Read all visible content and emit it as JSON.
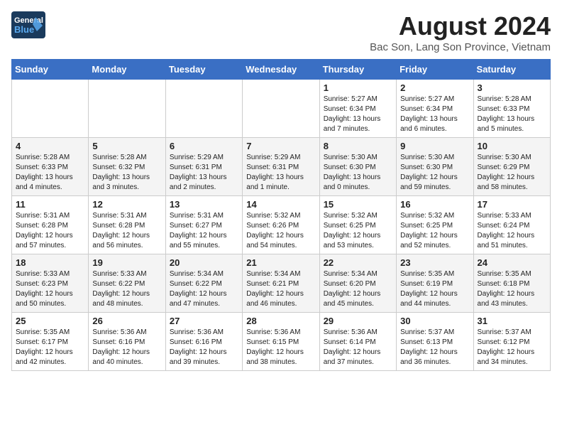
{
  "header": {
    "logo_text_general": "General",
    "logo_text_blue": "Blue",
    "month_title": "August 2024",
    "location": "Bac Son, Lang Son Province, Vietnam"
  },
  "weekdays": [
    "Sunday",
    "Monday",
    "Tuesday",
    "Wednesday",
    "Thursday",
    "Friday",
    "Saturday"
  ],
  "weeks": [
    [
      {
        "day": "",
        "info": ""
      },
      {
        "day": "",
        "info": ""
      },
      {
        "day": "",
        "info": ""
      },
      {
        "day": "",
        "info": ""
      },
      {
        "day": "1",
        "info": "Sunrise: 5:27 AM\nSunset: 6:34 PM\nDaylight: 13 hours\nand 7 minutes."
      },
      {
        "day": "2",
        "info": "Sunrise: 5:27 AM\nSunset: 6:34 PM\nDaylight: 13 hours\nand 6 minutes."
      },
      {
        "day": "3",
        "info": "Sunrise: 5:28 AM\nSunset: 6:33 PM\nDaylight: 13 hours\nand 5 minutes."
      }
    ],
    [
      {
        "day": "4",
        "info": "Sunrise: 5:28 AM\nSunset: 6:33 PM\nDaylight: 13 hours\nand 4 minutes."
      },
      {
        "day": "5",
        "info": "Sunrise: 5:28 AM\nSunset: 6:32 PM\nDaylight: 13 hours\nand 3 minutes."
      },
      {
        "day": "6",
        "info": "Sunrise: 5:29 AM\nSunset: 6:31 PM\nDaylight: 13 hours\nand 2 minutes."
      },
      {
        "day": "7",
        "info": "Sunrise: 5:29 AM\nSunset: 6:31 PM\nDaylight: 13 hours\nand 1 minute."
      },
      {
        "day": "8",
        "info": "Sunrise: 5:30 AM\nSunset: 6:30 PM\nDaylight: 13 hours\nand 0 minutes."
      },
      {
        "day": "9",
        "info": "Sunrise: 5:30 AM\nSunset: 6:30 PM\nDaylight: 12 hours\nand 59 minutes."
      },
      {
        "day": "10",
        "info": "Sunrise: 5:30 AM\nSunset: 6:29 PM\nDaylight: 12 hours\nand 58 minutes."
      }
    ],
    [
      {
        "day": "11",
        "info": "Sunrise: 5:31 AM\nSunset: 6:28 PM\nDaylight: 12 hours\nand 57 minutes."
      },
      {
        "day": "12",
        "info": "Sunrise: 5:31 AM\nSunset: 6:28 PM\nDaylight: 12 hours\nand 56 minutes."
      },
      {
        "day": "13",
        "info": "Sunrise: 5:31 AM\nSunset: 6:27 PM\nDaylight: 12 hours\nand 55 minutes."
      },
      {
        "day": "14",
        "info": "Sunrise: 5:32 AM\nSunset: 6:26 PM\nDaylight: 12 hours\nand 54 minutes."
      },
      {
        "day": "15",
        "info": "Sunrise: 5:32 AM\nSunset: 6:25 PM\nDaylight: 12 hours\nand 53 minutes."
      },
      {
        "day": "16",
        "info": "Sunrise: 5:32 AM\nSunset: 6:25 PM\nDaylight: 12 hours\nand 52 minutes."
      },
      {
        "day": "17",
        "info": "Sunrise: 5:33 AM\nSunset: 6:24 PM\nDaylight: 12 hours\nand 51 minutes."
      }
    ],
    [
      {
        "day": "18",
        "info": "Sunrise: 5:33 AM\nSunset: 6:23 PM\nDaylight: 12 hours\nand 50 minutes."
      },
      {
        "day": "19",
        "info": "Sunrise: 5:33 AM\nSunset: 6:22 PM\nDaylight: 12 hours\nand 48 minutes."
      },
      {
        "day": "20",
        "info": "Sunrise: 5:34 AM\nSunset: 6:22 PM\nDaylight: 12 hours\nand 47 minutes."
      },
      {
        "day": "21",
        "info": "Sunrise: 5:34 AM\nSunset: 6:21 PM\nDaylight: 12 hours\nand 46 minutes."
      },
      {
        "day": "22",
        "info": "Sunrise: 5:34 AM\nSunset: 6:20 PM\nDaylight: 12 hours\nand 45 minutes."
      },
      {
        "day": "23",
        "info": "Sunrise: 5:35 AM\nSunset: 6:19 PM\nDaylight: 12 hours\nand 44 minutes."
      },
      {
        "day": "24",
        "info": "Sunrise: 5:35 AM\nSunset: 6:18 PM\nDaylight: 12 hours\nand 43 minutes."
      }
    ],
    [
      {
        "day": "25",
        "info": "Sunrise: 5:35 AM\nSunset: 6:17 PM\nDaylight: 12 hours\nand 42 minutes."
      },
      {
        "day": "26",
        "info": "Sunrise: 5:36 AM\nSunset: 6:16 PM\nDaylight: 12 hours\nand 40 minutes."
      },
      {
        "day": "27",
        "info": "Sunrise: 5:36 AM\nSunset: 6:16 PM\nDaylight: 12 hours\nand 39 minutes."
      },
      {
        "day": "28",
        "info": "Sunrise: 5:36 AM\nSunset: 6:15 PM\nDaylight: 12 hours\nand 38 minutes."
      },
      {
        "day": "29",
        "info": "Sunrise: 5:36 AM\nSunset: 6:14 PM\nDaylight: 12 hours\nand 37 minutes."
      },
      {
        "day": "30",
        "info": "Sunrise: 5:37 AM\nSunset: 6:13 PM\nDaylight: 12 hours\nand 36 minutes."
      },
      {
        "day": "31",
        "info": "Sunrise: 5:37 AM\nSunset: 6:12 PM\nDaylight: 12 hours\nand 34 minutes."
      }
    ]
  ]
}
